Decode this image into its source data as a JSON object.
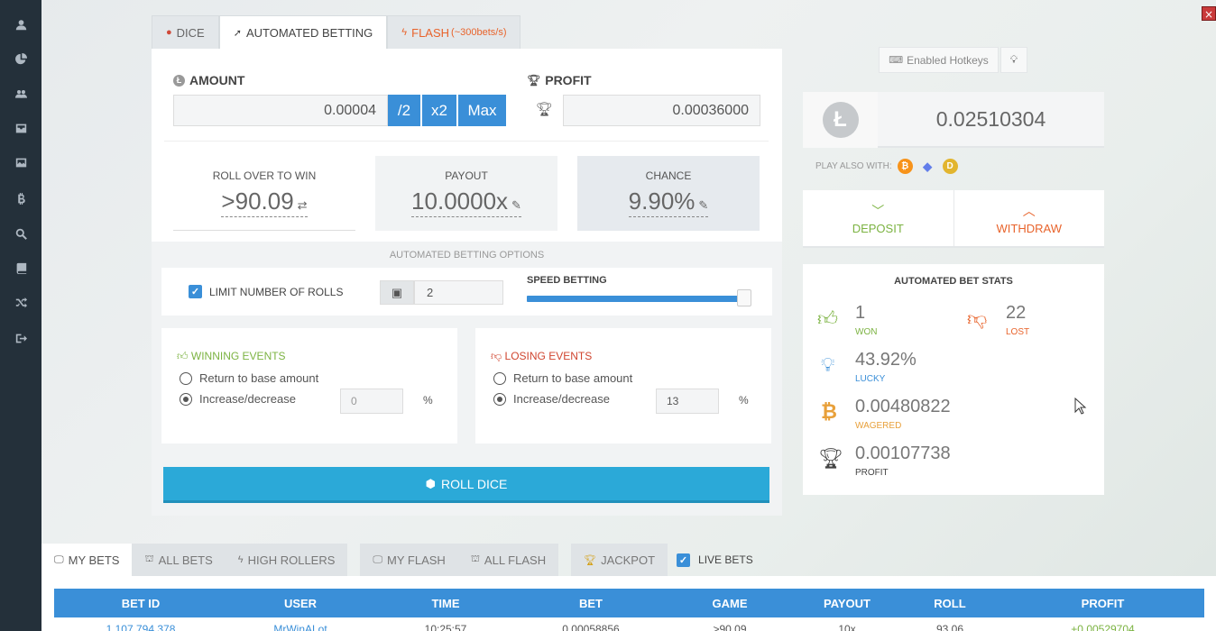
{
  "nav": {
    "items": [
      "user-icon",
      "pie-chart-icon",
      "users-icon",
      "inbox-icon",
      "image-icon",
      "bitcoin-icon",
      "search-icon",
      "book-icon",
      "shuffle-icon",
      "sign-out-icon"
    ]
  },
  "tabs": {
    "dice": "DICE",
    "automated": "AUTOMATED BETTING",
    "flash": "FLASH",
    "flash_rate": "(~300bets/s)"
  },
  "amount": {
    "label": "AMOUNT",
    "value": "0.00004",
    "half": "/2",
    "double": "x2",
    "max": "Max"
  },
  "profit": {
    "label": "PROFIT",
    "value": "0.00036000"
  },
  "roll": {
    "roll_over_label": "ROLL OVER TO WIN",
    "roll_over_value": ">90.09",
    "payout_label": "PAYOUT",
    "payout_value": "10.0000x",
    "chance_label": "CHANCE",
    "chance_value": "9.90%"
  },
  "options": {
    "title": "AUTOMATED BETTING OPTIONS",
    "limit_rolls_label": "LIMIT NUMBER OF ROLLS",
    "limit_rolls_checked": true,
    "rolls_value": "2",
    "speed_label": "SPEED BETTING",
    "speed_level": 1.0
  },
  "winning": {
    "title": "WINNING EVENTS",
    "option_return": "Return to base amount",
    "option_change": "Increase/decrease",
    "selected": "Increase/decrease",
    "percent_value": "0",
    "percent_sign": "%"
  },
  "losing": {
    "title": "LOSING EVENTS",
    "option_return": "Return to base amount",
    "option_change": "Increase/decrease",
    "selected": "Increase/decrease",
    "percent_value": "13",
    "percent_sign": "%"
  },
  "roll_button": "ROLL DICE",
  "right": {
    "hotkeys": "Enabled Hotkeys",
    "balance": "0.02510304",
    "coin_symbol": "Ł",
    "play_also": "PLAY ALSO WITH:",
    "deposit": "DEPOSIT",
    "withdraw": "WITHDRAW"
  },
  "stats": {
    "title": "AUTOMATED BET STATS",
    "won_value": "1",
    "won_label": "WON",
    "lost_value": "22",
    "lost_label": "LOST",
    "lucky_value": "43.92%",
    "lucky_label": "LUCKY",
    "wagered_value": "0.00480822",
    "wagered_label": "WAGERED",
    "profit_value": "0.00107738",
    "profit_label": "PROFIT"
  },
  "bets": {
    "tabs": {
      "my_bets": "MY BETS",
      "all_bets": "ALL BETS",
      "high_rollers": "HIGH ROLLERS",
      "my_flash": "MY FLASH",
      "all_flash": "ALL FLASH",
      "jackpot": "JACKPOT",
      "live_bets": "LIVE BETS"
    },
    "columns": [
      "BET ID",
      "USER",
      "TIME",
      "BET",
      "GAME",
      "PAYOUT",
      "ROLL",
      "PROFIT"
    ],
    "rows": [
      [
        "1,107,794,378",
        "MrWinALot",
        "10:25:57",
        "0.00058856",
        ">90.09",
        "10x",
        "93.06",
        "+0.00529704"
      ]
    ]
  },
  "colors": {
    "accent_blue": "#3a8fd8",
    "roll_button": "#2ba9d8",
    "nav_bg": "#24303a",
    "won_green": "#7cb342",
    "lost_orange": "#e8632b",
    "deposit_green": "#7cb342",
    "withdraw_orange": "#e8632b",
    "bitcoin": "#f7931a",
    "dogecoin": "#e2b52f"
  }
}
